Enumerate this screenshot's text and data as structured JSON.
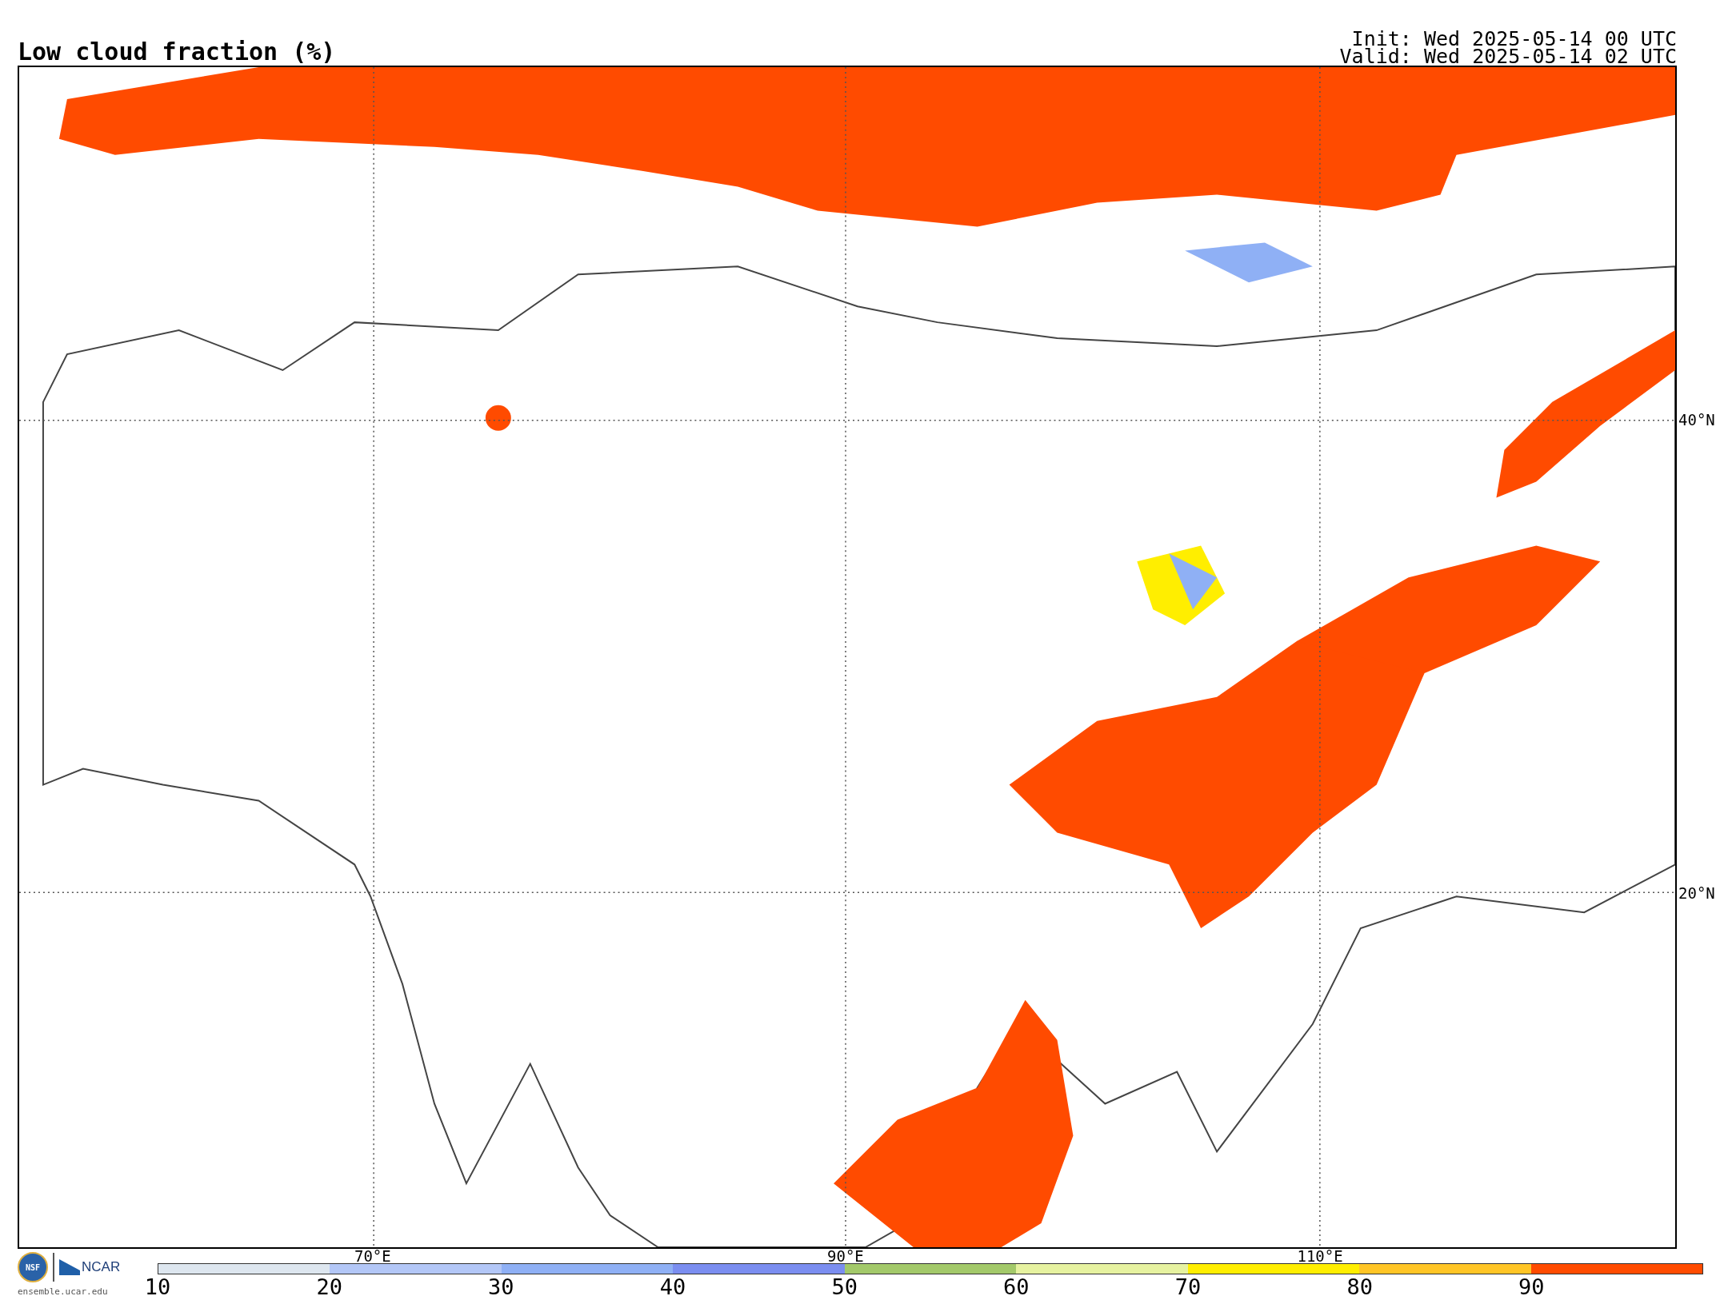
{
  "title": "Low cloud fraction (%)",
  "init": "Init: Wed 2025-05-14 00 UTC",
  "valid": "Valid: Wed 2025-05-14 02 UTC",
  "map": {
    "kind": "map-picture",
    "longitude_labels": [
      "70°E",
      "90°E",
      "110°E"
    ],
    "latitude_labels": [
      "40°N",
      "20°N"
    ]
  },
  "logo": {
    "seal": "NSF",
    "name": "NCAR",
    "url": "ensemble.ucar.edu"
  },
  "colorbar": {
    "ticks": [
      "10",
      "20",
      "30",
      "40",
      "50",
      "60",
      "70",
      "80",
      "90"
    ],
    "bins": [
      {
        "color": "#dde6ef"
      },
      {
        "color": "#b3c7f7"
      },
      {
        "color": "#8fb0f5"
      },
      {
        "color": "#7b8ef0"
      },
      {
        "color": "#a3c96a"
      },
      {
        "color": "#e6f2a0"
      },
      {
        "color": "#ffee00"
      },
      {
        "color": "#ffc526"
      },
      {
        "color": "#ff4b00"
      }
    ]
  }
}
